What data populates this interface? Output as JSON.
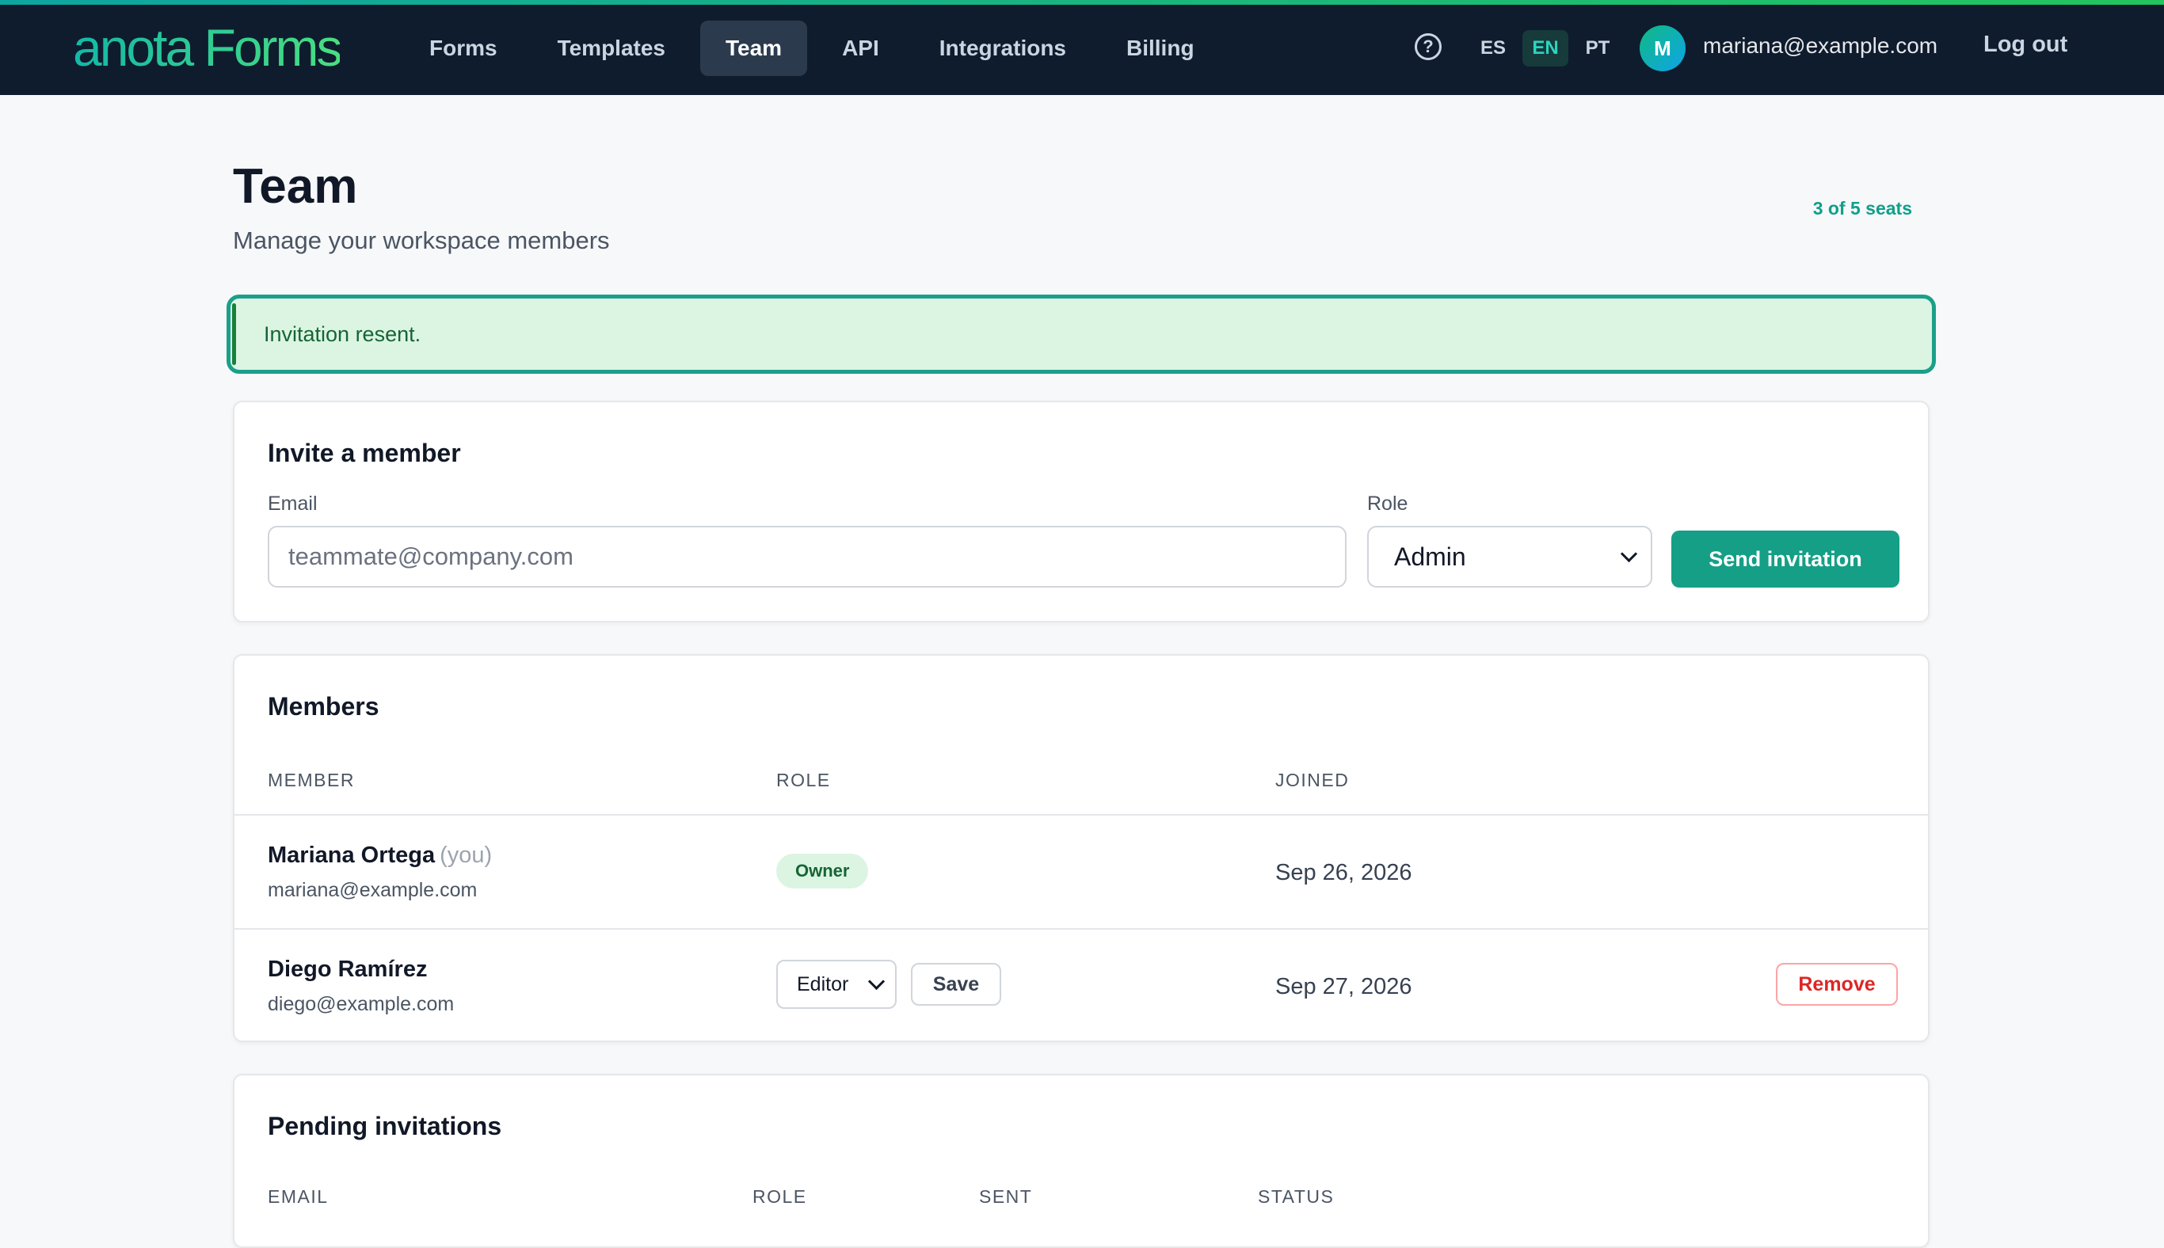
{
  "app": {
    "logo": "anota Forms",
    "nav": [
      "Forms",
      "Templates",
      "Team",
      "API",
      "Integrations",
      "Billing"
    ],
    "active_nav": "Team",
    "help_icon": "question-circle-icon",
    "languages": [
      "ES",
      "EN",
      "PT"
    ],
    "active_language": "EN",
    "user": {
      "avatar_initial": "M",
      "email": "mariana@example.com"
    },
    "logout_label": "Log out"
  },
  "header": {
    "title": "Team",
    "subtitle": "Manage your workspace members",
    "seats": "3 of 5 seats"
  },
  "alert": {
    "text": "Invitation resent."
  },
  "invite": {
    "title": "Invite a member",
    "email_label": "Email",
    "email_placeholder": "teammate@company.com",
    "email_value": "",
    "role_label": "Role",
    "role_value": "Admin",
    "send_label": "Send invitation"
  },
  "members": {
    "title": "Members",
    "columns": [
      "MEMBER",
      "ROLE",
      "JOINED"
    ],
    "rows": [
      {
        "name": "Mariana Ortega",
        "you_tag": "(you)",
        "email": "mariana@example.com",
        "role": "Owner",
        "joined": "Sep 26, 2026"
      },
      {
        "name": "Diego Ramírez",
        "email": "diego@example.com",
        "role": "Editor",
        "save_label": "Save",
        "joined": "Sep 27, 2026",
        "remove_label": "Remove"
      }
    ]
  },
  "pending": {
    "title": "Pending invitations",
    "columns": [
      "EMAIL",
      "ROLE",
      "SENT",
      "STATUS"
    ]
  },
  "colors": {
    "topbar": "#0f1c2e",
    "accent": "#159f86",
    "success_bg": "#dcf5e3",
    "danger": "#dc2626"
  }
}
